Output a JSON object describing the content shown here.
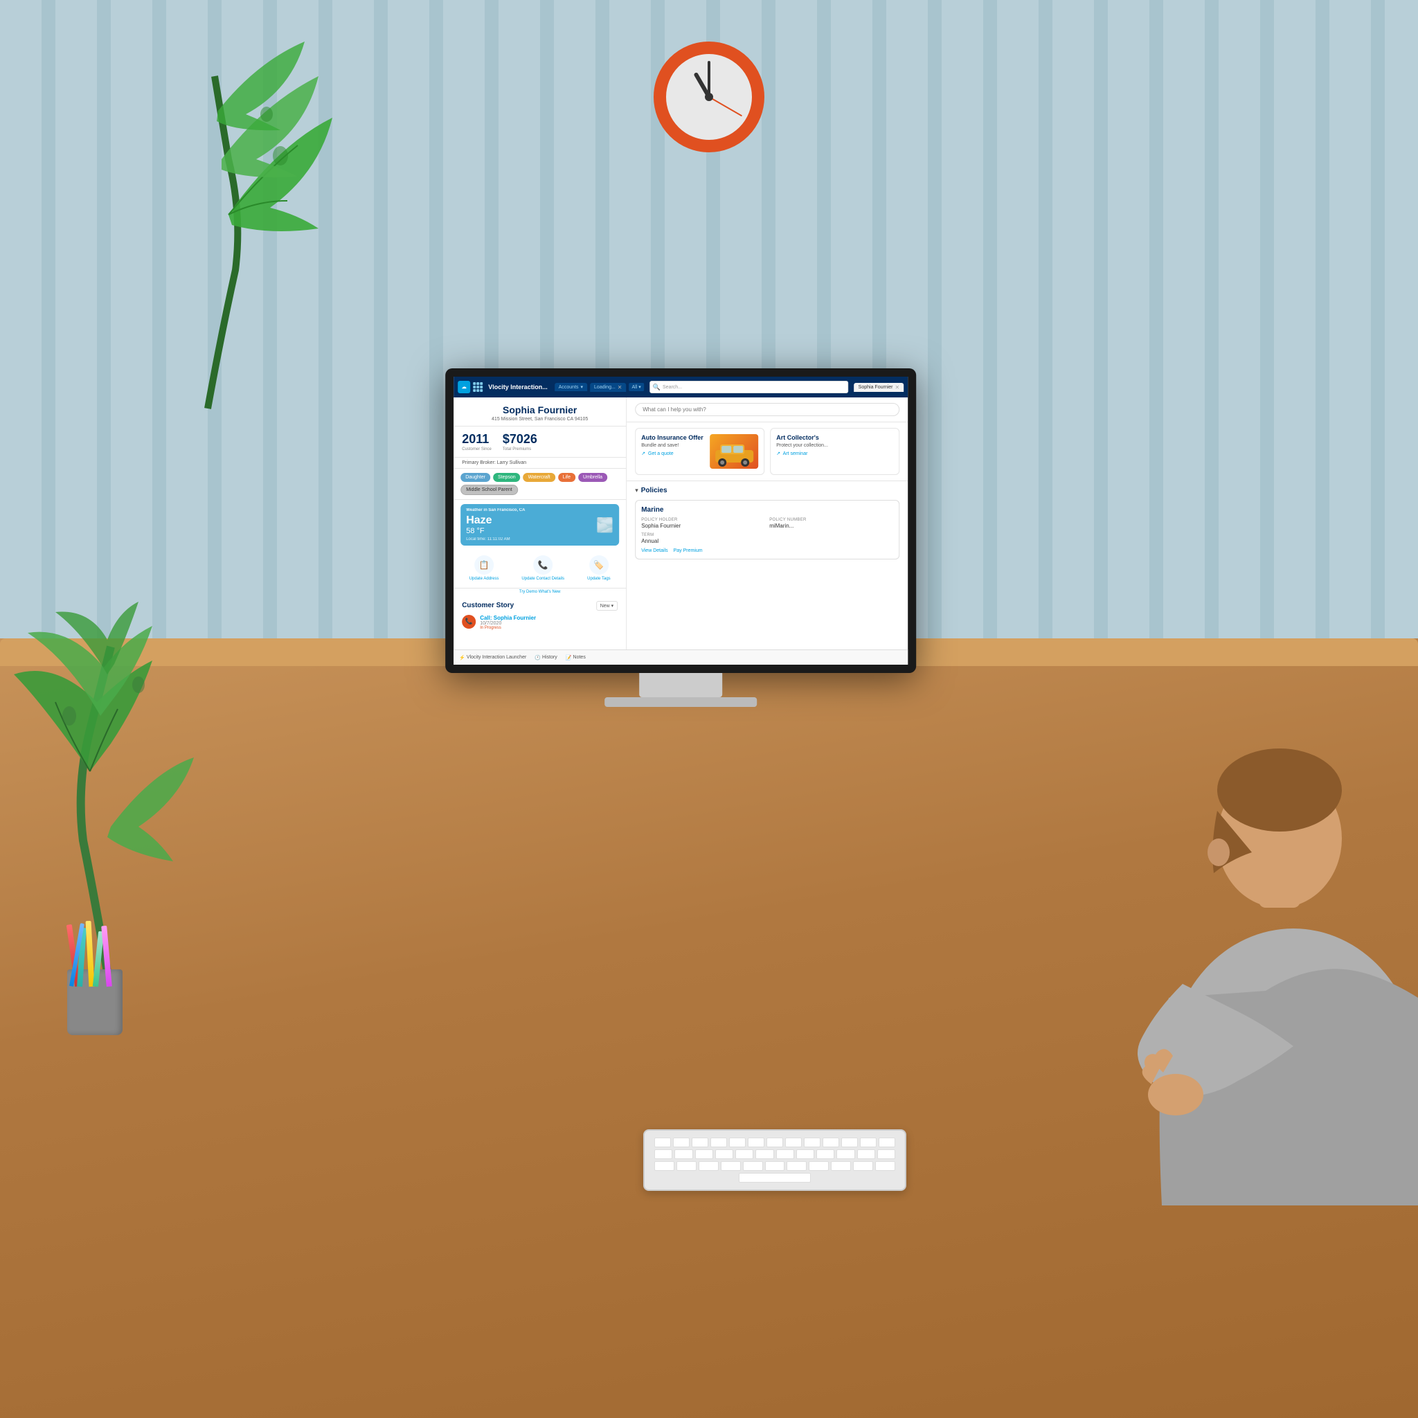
{
  "scene": {
    "clock": {
      "label": "Clock showing approximately 11:11"
    }
  },
  "nav": {
    "app_name": "Vlocity Interaction...",
    "tabs": [
      {
        "label": "Accounts",
        "active": false,
        "has_close": false
      },
      {
        "label": "Loading...",
        "active": false,
        "has_close": true
      },
      {
        "label": "Sophia Fournier",
        "active": true,
        "has_close": true
      }
    ],
    "search_placeholder": "Search...",
    "all_label": "All"
  },
  "customer": {
    "name": "Sophia Fournier",
    "address": "415 Mission Street, San Francisco CA 94105",
    "customer_since": "2011",
    "customer_since_label": "Customer Since",
    "total_premiums": "$7026",
    "total_premiums_label": "Total Premiums",
    "primary_broker": "Primary Broker: Larry Sullivan",
    "tags": [
      {
        "label": "Daughter",
        "class": "tag-daughter"
      },
      {
        "label": "Stepson",
        "class": "tag-stepson"
      },
      {
        "label": "Watercraft",
        "class": "tag-watercraft"
      },
      {
        "label": "Life",
        "class": "tag-life"
      },
      {
        "label": "Umbrella",
        "class": "tag-umbrella"
      },
      {
        "label": "Middle School Parent",
        "class": "tag-msp"
      }
    ]
  },
  "weather": {
    "city": "Weather in San Francisco, CA",
    "condition": "Haze",
    "temp": "58 °F",
    "local_time_label": "Local time: 11:11:02 AM"
  },
  "actions": [
    {
      "icon": "📋",
      "label": "Update Address"
    },
    {
      "icon": "📞",
      "label": "Update Contact Details"
    },
    {
      "icon": "🏷️",
      "label": "Update Tags"
    }
  ],
  "demo_link": "Try Demo What's New",
  "customer_story": {
    "title": "Customer Story",
    "new_button": "New ▾",
    "items": [
      {
        "type": "Call",
        "title": "Call: Sophia Fournier",
        "date": "10/7/2020",
        "status": "In Progress"
      }
    ]
  },
  "bottom_tabs": [
    {
      "icon": "⚡",
      "label": "Vlocity Interaction Launcher"
    },
    {
      "icon": "🕐",
      "label": "History"
    },
    {
      "icon": "📝",
      "label": "Notes"
    }
  ],
  "assist": {
    "search_placeholder": "What can I help you with?"
  },
  "offers": [
    {
      "id": "auto",
      "title": "Auto Insurance Offer",
      "subtitle": "Bundle and save!",
      "link": "Get a quote",
      "has_image": true
    },
    {
      "id": "art",
      "title": "Art Collector's",
      "subtitle": "Protect your collection...",
      "link": "Art seminar"
    }
  ],
  "policies": {
    "section_title": "Policies",
    "items": [
      {
        "type": "Marine",
        "policy_holder_label": "POLICY HOLDER",
        "policy_holder": "Sophia Fournier",
        "policy_number_label": "POLICY NUMBER",
        "policy_number": "miMarin...",
        "term_label": "TERM",
        "term": "Annual",
        "actions": [
          {
            "label": "View Details"
          },
          {
            "label": "Pay Premium"
          }
        ]
      }
    ]
  }
}
